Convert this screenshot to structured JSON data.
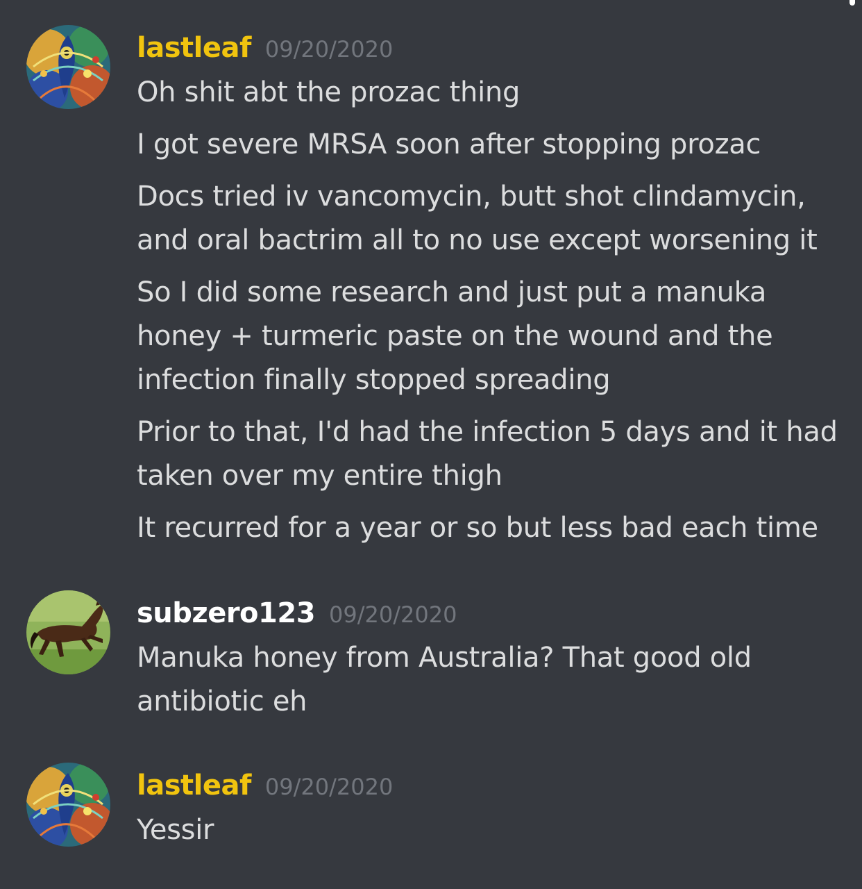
{
  "channel": {
    "messages": [
      {
        "author": "lastleaf",
        "timestamp": "09/20/2020",
        "avatar": "psychedelic-peacock-avatar",
        "author_color": "#f1c40f",
        "lines": [
          "Oh shit abt the prozac thing",
          "I got severe MRSA soon after stopping prozac",
          "Docs tried iv vancomycin, butt shot clindamycin, and oral bactrim all to no use except worsening it",
          "So I did some research and just put a manuka honey + turmeric paste on the wound and the infection finally stopped spreading",
          "Prior to that, I'd had the infection 5 days and it had taken over my entire thigh",
          "It recurred for a year or so but less bad each time"
        ]
      },
      {
        "author": "subzero123",
        "timestamp": "09/20/2020",
        "avatar": "horse-avatar",
        "author_color": "#ffffff",
        "lines": [
          "Manuka honey from Australia? That good old antibiotic eh"
        ]
      },
      {
        "author": "lastleaf",
        "timestamp": "09/20/2020",
        "avatar": "psychedelic-peacock-avatar",
        "author_color": "#f1c40f",
        "lines": [
          "Yessir"
        ]
      }
    ]
  }
}
